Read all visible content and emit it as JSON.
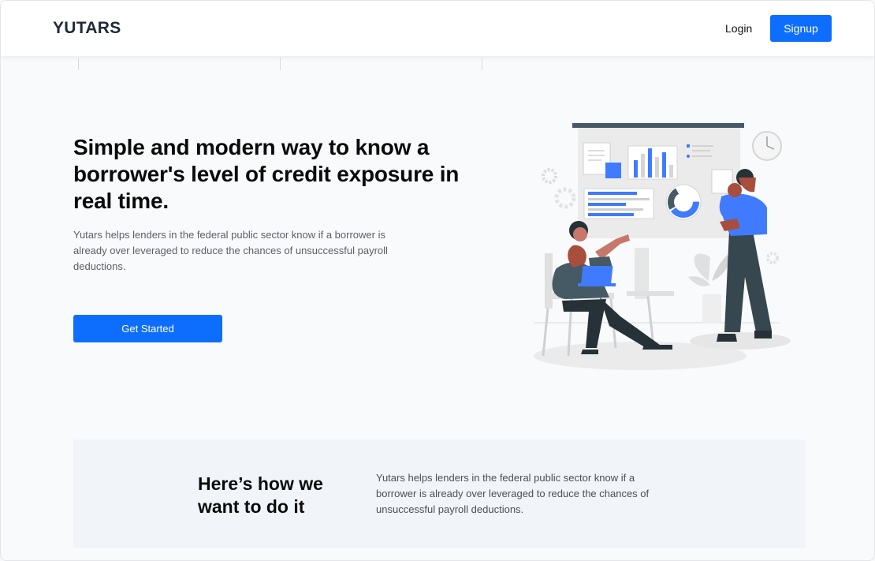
{
  "navbar": {
    "logo": "YUTARS",
    "login_label": "Login",
    "signup_label": "Signup"
  },
  "hero": {
    "title": "Simple and modern way to know a borrower's level of credit exposure in real time.",
    "description": "Yutars helps lenders in the federal public sector know if a borrower is already over leveraged to reduce the chances of unsuccessful payroll deductions.",
    "cta_label": "Get Started",
    "illustration_icon": "credit-analysis-illustration"
  },
  "how_section": {
    "title": "Here’s how we want to do it",
    "description": "Yutars helps lenders in the federal public sector know if a borrower is already over leveraged to reduce the chances of unsuccessful payroll deductions."
  },
  "colors": {
    "primary": "#0d6efd",
    "background": "#f9fafb",
    "section_background": "#f1f4f9",
    "text": "#0b0b0b"
  }
}
